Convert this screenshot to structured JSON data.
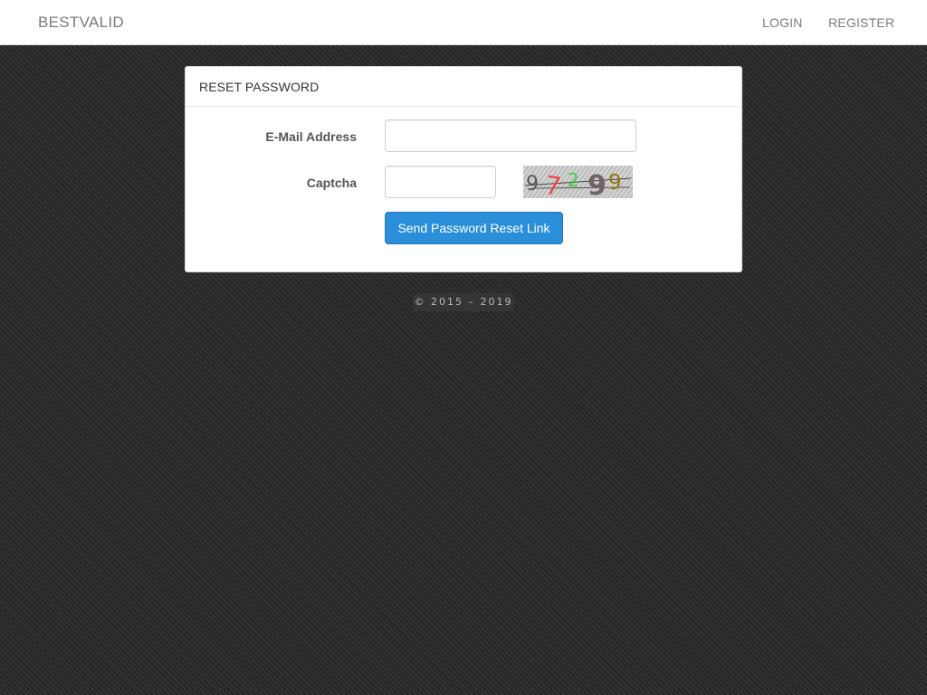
{
  "navbar": {
    "brand": "BESTVALID",
    "login_label": "LOGIN",
    "register_label": "REGISTER"
  },
  "panel": {
    "heading": "RESET PASSWORD",
    "email_label": "E-Mail Address",
    "email_value": "",
    "captcha_label": "Captcha",
    "captcha_value": "",
    "captcha_text": "97299",
    "submit_label": "Send Password Reset Link"
  },
  "footer": {
    "copyright": "© 2015 – 2019"
  },
  "colors": {
    "primary_button": "#2a8fd8",
    "nav_text": "#7a7a7a",
    "background": "#2c2c2c"
  }
}
